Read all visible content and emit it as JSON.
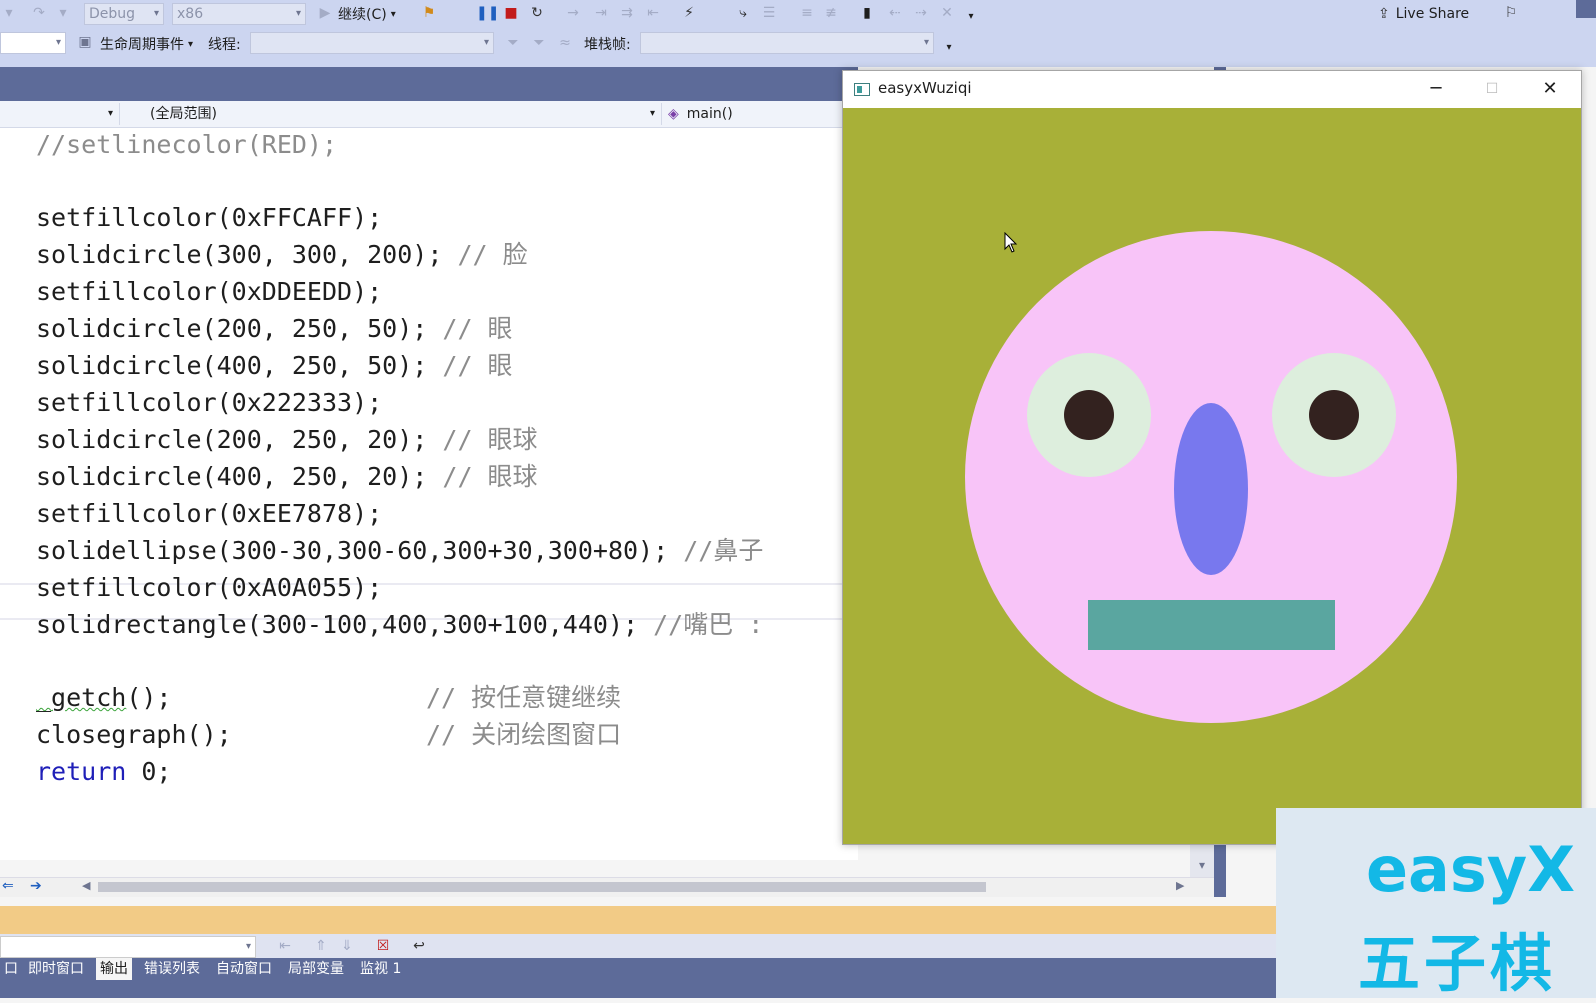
{
  "toolbar": {
    "config": "Debug",
    "platform": "x86",
    "continue_label": "继续(C)",
    "live_share": "Live Share"
  },
  "debug_bar": {
    "lifecycle_label": "生命周期事件",
    "thread_label": "线程:",
    "stackframe_label": "堆栈帧:"
  },
  "nav": {
    "scope": "(全局范围)",
    "function": "main()"
  },
  "code": {
    "l1": "//setlinecolor(RED);",
    "l2": "setfillcolor(0xFFCAFF);",
    "l3a": "solidcircle(300, 300, 200); ",
    "l3b": "// 脸",
    "l4": "setfillcolor(0xDDEEDD);",
    "l5a": "solidcircle(200, 250, 50); ",
    "l5b": "// 眼",
    "l6a": "solidcircle(400, 250, 50); ",
    "l6b": "// 眼",
    "l7": "setfillcolor(0x222333);",
    "l8a": "solidcircle(200, 250, 20); ",
    "l8b": "// 眼球",
    "l9a": "solidcircle(400, 250, 20); ",
    "l9b": "// 眼球",
    "l10": "setfillcolor(0xEE7878);",
    "l11a": "solidellipse(300-30,300-60,300+30,300+80); ",
    "l11b": "//鼻子",
    "l12": "setfillcolor(0xA0A055);",
    "l13a": "solidrectangle(300-100,400,300+100,440); ",
    "l13b": "//嘴巴 :",
    "l14a": "_getch",
    "l14b": "();",
    "l14c": "// 按任意键继续",
    "l15a": "closegraph();",
    "l15b": "// 关闭绘图窗口",
    "l16a": "return",
    "l16b": " 0;"
  },
  "window": {
    "title": "easyxWuziqi"
  },
  "drawing": {
    "background": "#a8b038",
    "face": "#f8c4f8",
    "eye_white": "#ddeedd",
    "pupil": "#33221f",
    "nose": "#7878ee",
    "mouth": "#5aa6a0"
  },
  "bottom_tabs": [
    "口",
    "即时窗口",
    "输出",
    "错误列表",
    "自动窗口",
    "局部变量",
    "监视 1"
  ],
  "banner": {
    "line1": "easyX",
    "line2": "五子棋"
  }
}
